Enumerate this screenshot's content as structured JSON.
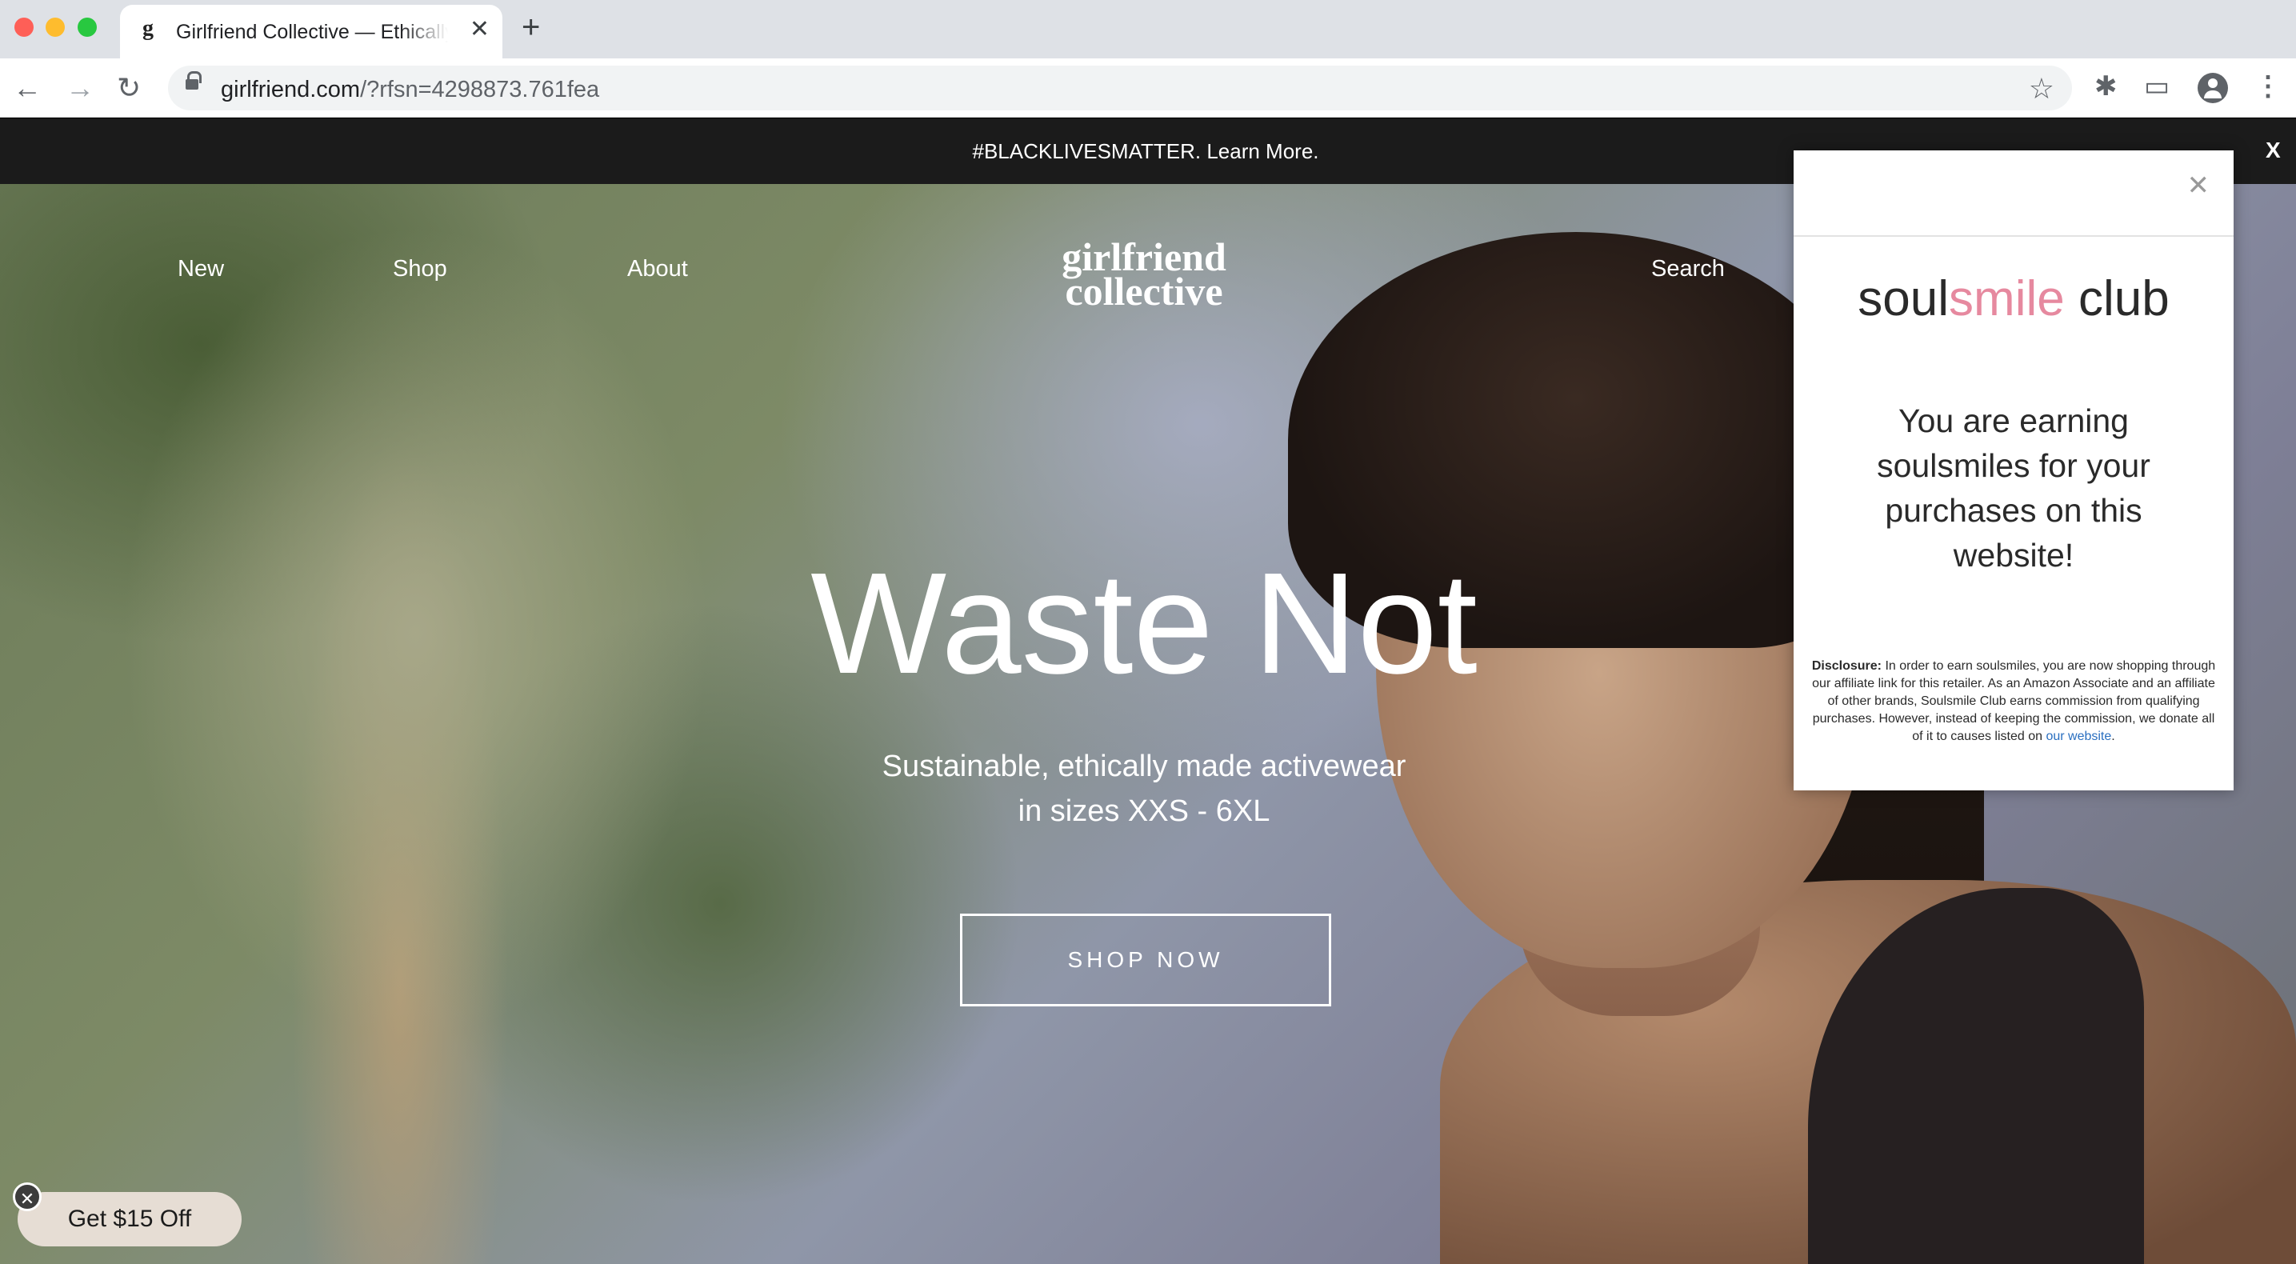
{
  "browser": {
    "tab_title": "Girlfriend Collective — Ethically",
    "tab_favicon": "g",
    "url_host": "girlfriend.com",
    "url_rest": "/?rfsn=4298873.761fea"
  },
  "site": {
    "banner_text": "#BLACKLIVESMATTER. Learn More.",
    "banner_close": "X",
    "nav": {
      "new": "New",
      "shop": "Shop",
      "about": "About",
      "search": "Search"
    },
    "logo_line1": "girlfriend",
    "logo_line2": "collective",
    "headline": "Waste Not",
    "subhead_line1": "Sustainable, ethically made activewear",
    "subhead_line2": "in sizes XXS - 6XL",
    "cta": "SHOP NOW",
    "promo": "Get $15 Off"
  },
  "popup": {
    "brand_soul": "soul",
    "brand_smile": "smile",
    "brand_club": " club",
    "message": "You are earning soulsmiles for your purchases on this website!",
    "disclosure_label": "Disclosure:",
    "disclosure_text": " In order to earn soulsmiles, you are now shopping through our affiliate link for this retailer. As an Amazon Associate and an affiliate of other brands, Soulsmile Club earns commission from qualifying purchases. However, instead of keeping the commission, we donate all of it to causes listed on ",
    "disclosure_link": "our website",
    "disclosure_end": "."
  },
  "colors": {
    "brand_pink": "#e6899f",
    "banner_bg": "#1b1b1b",
    "promo_bg": "#e6ddd4"
  },
  "icons": [
    "back-icon",
    "forward-icon",
    "reload-icon",
    "lock-icon",
    "star-icon",
    "extensions-icon",
    "cast-icon",
    "profile-icon",
    "menu-icon",
    "close-icon"
  ]
}
